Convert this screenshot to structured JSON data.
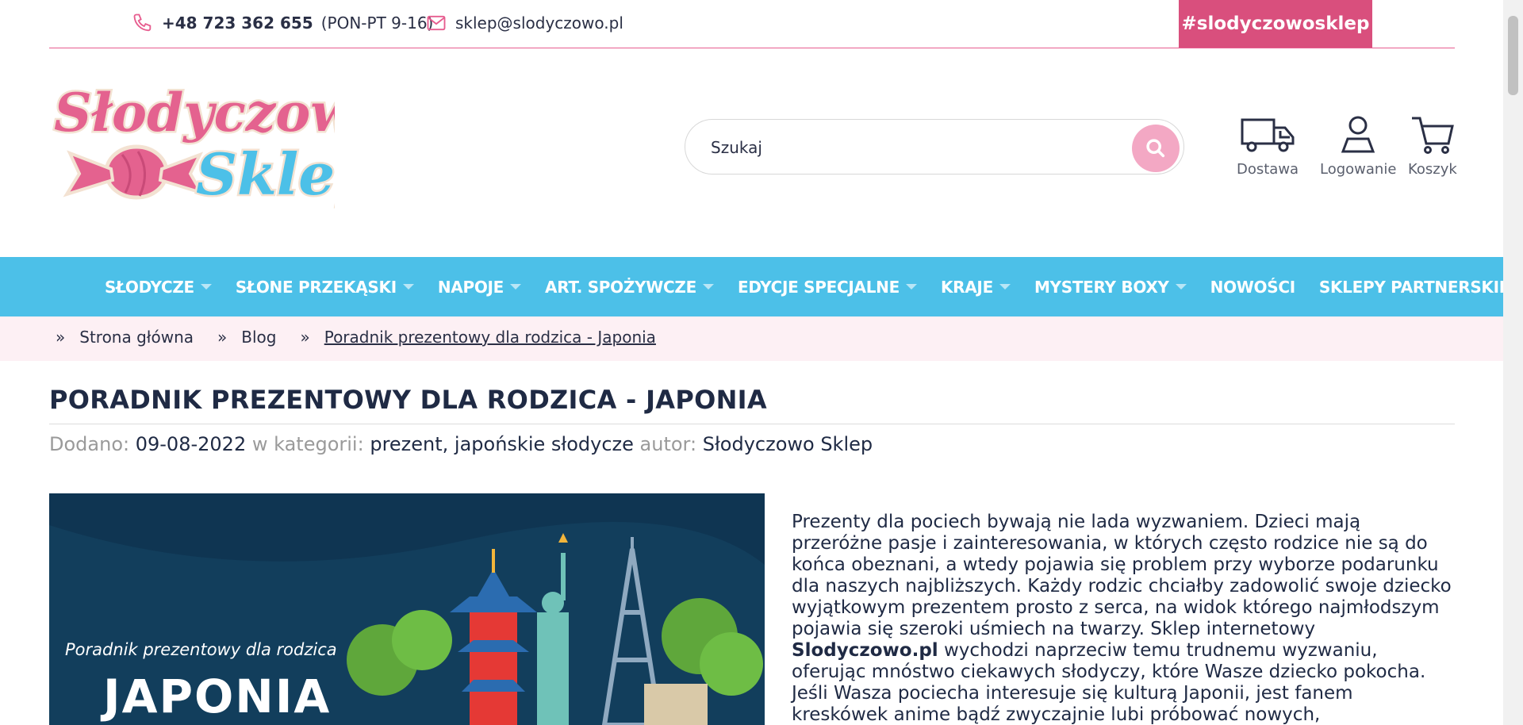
{
  "topbar": {
    "phone": "+48 723 362 655",
    "hours": "(PON-PT 9-16)",
    "email": "sklep@slodyczowo.pl",
    "hashtag": "#slodyczowosklep"
  },
  "logo": {
    "line1": "Słodyczowo",
    "line2": "Sklep"
  },
  "search": {
    "placeholder": "Szukaj"
  },
  "header_items": {
    "delivery": "Dostawa",
    "login": "Logowanie",
    "cart": "Koszyk"
  },
  "nav": {
    "items": [
      {
        "label": "SŁODYCZE",
        "dropdown": true
      },
      {
        "label": "SŁONE PRZEKĄSKI",
        "dropdown": true
      },
      {
        "label": "NAPOJE",
        "dropdown": true
      },
      {
        "label": "ART. SPOŻYWCZE",
        "dropdown": true
      },
      {
        "label": "EDYCJE SPECJALNE",
        "dropdown": true
      },
      {
        "label": "KRAJE",
        "dropdown": true
      },
      {
        "label": "MYSTERY BOXY",
        "dropdown": true
      },
      {
        "label": "NOWOŚCI",
        "dropdown": false
      },
      {
        "label": "SKLEPY PARTNERSKIE",
        "dropdown": true
      }
    ]
  },
  "breadcrumb": {
    "separator": "»",
    "home": "Strona główna",
    "blog": "Blog",
    "current": "Poradnik prezentowy dla rodzica - Japonia"
  },
  "article": {
    "title": "PORADNIK PREZENTOWY DLA RODZICA - JAPONIA",
    "meta": {
      "added_label": "Dodano:",
      "date": "09-08-2022",
      "category_label": "w kategorii:",
      "categories": "prezent, japońskie słodycze",
      "author_label": "autor:",
      "author": "Słodyczowo Sklep"
    },
    "hero": {
      "subtitle": "Poradnik prezentowy dla rodzica",
      "headline": "JAPONIA"
    },
    "body": {
      "part1": "Prezenty dla pociech bywają nie lada wyzwaniem. Dzieci mają przeróżne pasje i zainteresowania, w których często rodzice nie są do końca obeznani, a wtedy pojawia się problem przy wyborze podarunku dla naszych najbliższych. Każdy rodzic chciałby zadowolić swoje dziecko wyjątkowym prezentem prosto z serca, na widok którego najmłodszym pojawia się szeroki uśmiech na twarzy. Sklep internetowy ",
      "strong": "Slodyczowo.pl",
      "part2": " wychodzi naprzeciw temu trudnemu wyzwaniu, oferując mnóstwo ciekawych słodyczy, które Wasze dziecko pokocha. Jeśli Wasza pociecha interesuje się kulturą Japonii, jest fanem kreskówek anime bądź zwyczajnie lubi próbować nowych,"
    }
  },
  "colors": {
    "accent_pink": "#d94f7d",
    "nav_blue": "#4cc0e8",
    "breadcrumb_bg": "#fdf0f4"
  }
}
